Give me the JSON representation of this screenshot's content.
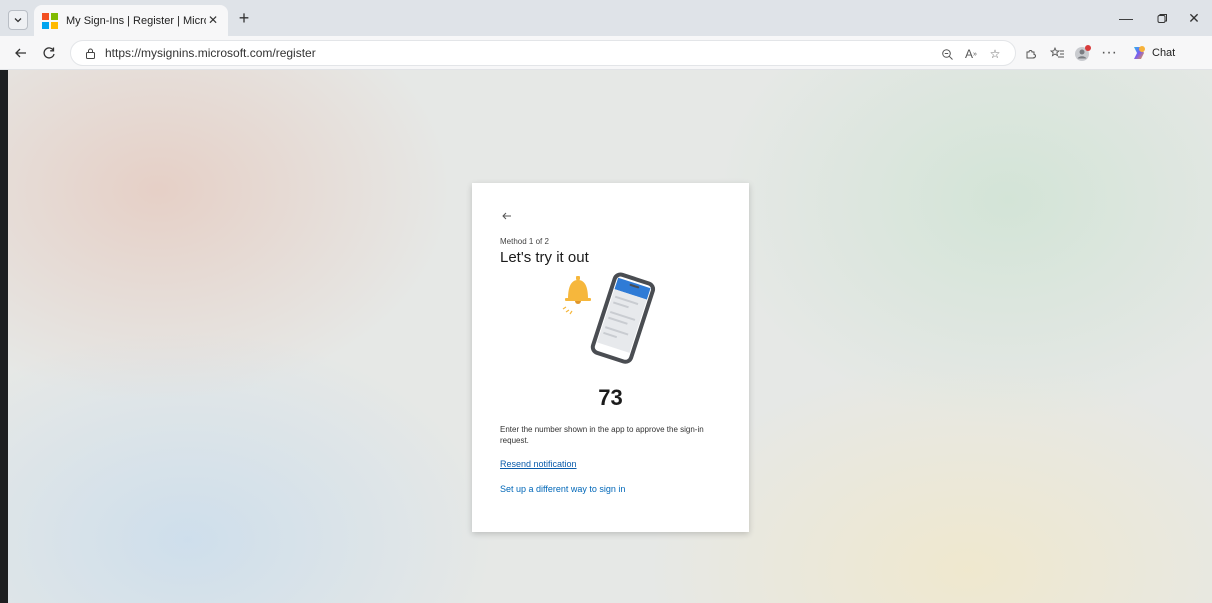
{
  "browser": {
    "tab_title": "My Sign-Ins | Register | Microsoft",
    "url": "https://mysignins.microsoft.com/register",
    "chat_label": "Chat",
    "icons": [
      "tab-list-icon",
      "microsoft-favicon",
      "close-tab-icon",
      "new-tab-icon",
      "minimize-icon",
      "restore-icon",
      "close-window-icon",
      "back-icon",
      "refresh-icon",
      "site-info-icon",
      "zoom-icon",
      "read-aloud-icon",
      "favorite-icon",
      "extensions-icon",
      "favorites-icon",
      "profile-icon",
      "more-icon",
      "copilot-icon"
    ]
  },
  "card": {
    "method_label": "Method 1 of 2",
    "heading": "Let's try it out",
    "number": "73",
    "instruction": "Enter the number shown in the app to approve the sign-in request.",
    "resend_link": "Resend notification",
    "different_link": "Set up a different way to sign in"
  },
  "colors": {
    "accent": "#0067b8",
    "phone_header": "#2f7bd6",
    "bell": "#f6b73c"
  }
}
